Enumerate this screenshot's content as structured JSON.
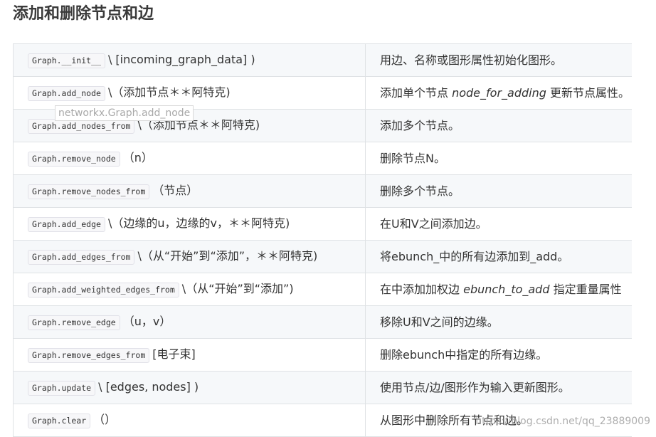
{
  "section_title": "添加和删除节点和边",
  "rows": [
    {
      "method": "Graph.__init__",
      "args": "\\ [incoming_graph_data] )",
      "desc": [
        {
          "text": "用边、名称或图形属性初始化图形。",
          "italic": false
        }
      ]
    },
    {
      "method": "Graph.add_node",
      "args": "\\（添加节点＊＊阿特克)",
      "desc": [
        {
          "text": "添加单个节点 ",
          "italic": false
        },
        {
          "text": "node_for_adding",
          "italic": true
        },
        {
          "text": " 更新节点属性。",
          "italic": false
        }
      ]
    },
    {
      "method": "Graph.add_nodes_from",
      "args": "\\（添加节点＊＊阿特克)",
      "desc": [
        {
          "text": "添加多个节点。",
          "italic": false
        }
      ]
    },
    {
      "method": "Graph.remove_node",
      "args": "（n）",
      "desc": [
        {
          "text": "删除节点N。",
          "italic": false
        }
      ]
    },
    {
      "method": "Graph.remove_nodes_from",
      "args": "（节点）",
      "desc": [
        {
          "text": "删除多个节点。",
          "italic": false
        }
      ]
    },
    {
      "method": "Graph.add_edge",
      "args": "\\（边缘的u，边缘的v，＊＊阿特克)",
      "desc": [
        {
          "text": "在U和V之间添加边。",
          "italic": false
        }
      ]
    },
    {
      "method": "Graph.add_edges_from",
      "args": "\\（从“开始”到“添加”，＊＊阿特克)",
      "desc": [
        {
          "text": "将ebunch_中的所有边添加到_add。",
          "italic": false
        }
      ]
    },
    {
      "method": "Graph.add_weighted_edges_from",
      "args": "\\（从“开始”到“添加”)",
      "desc": [
        {
          "text": "在中添加加权边 ",
          "italic": false
        },
        {
          "text": "ebunch_to_add",
          "italic": true
        },
        {
          "text": " 指定重量属性",
          "italic": false
        }
      ]
    },
    {
      "method": "Graph.remove_edge",
      "args": "（u，v）",
      "desc": [
        {
          "text": "移除U和V之间的边缘。",
          "italic": false
        }
      ]
    },
    {
      "method": "Graph.remove_edges_from",
      "args": "[电子束]",
      "desc": [
        {
          "text": "删除ebunch中指定的所有边缘。",
          "italic": false
        }
      ]
    },
    {
      "method": "Graph.update",
      "args": "\\ [edges, nodes] )",
      "desc": [
        {
          "text": "使用节点/边/图形作为输入更新图形。",
          "italic": false
        }
      ]
    },
    {
      "method": "Graph.clear",
      "args": "（）",
      "desc": [
        {
          "text": "从图形中删除所有节点和边。",
          "italic": false
        }
      ]
    }
  ],
  "tooltip": "networkx.Graph.add_node",
  "watermark": "https://blog.csdn.net/qq_23889009"
}
